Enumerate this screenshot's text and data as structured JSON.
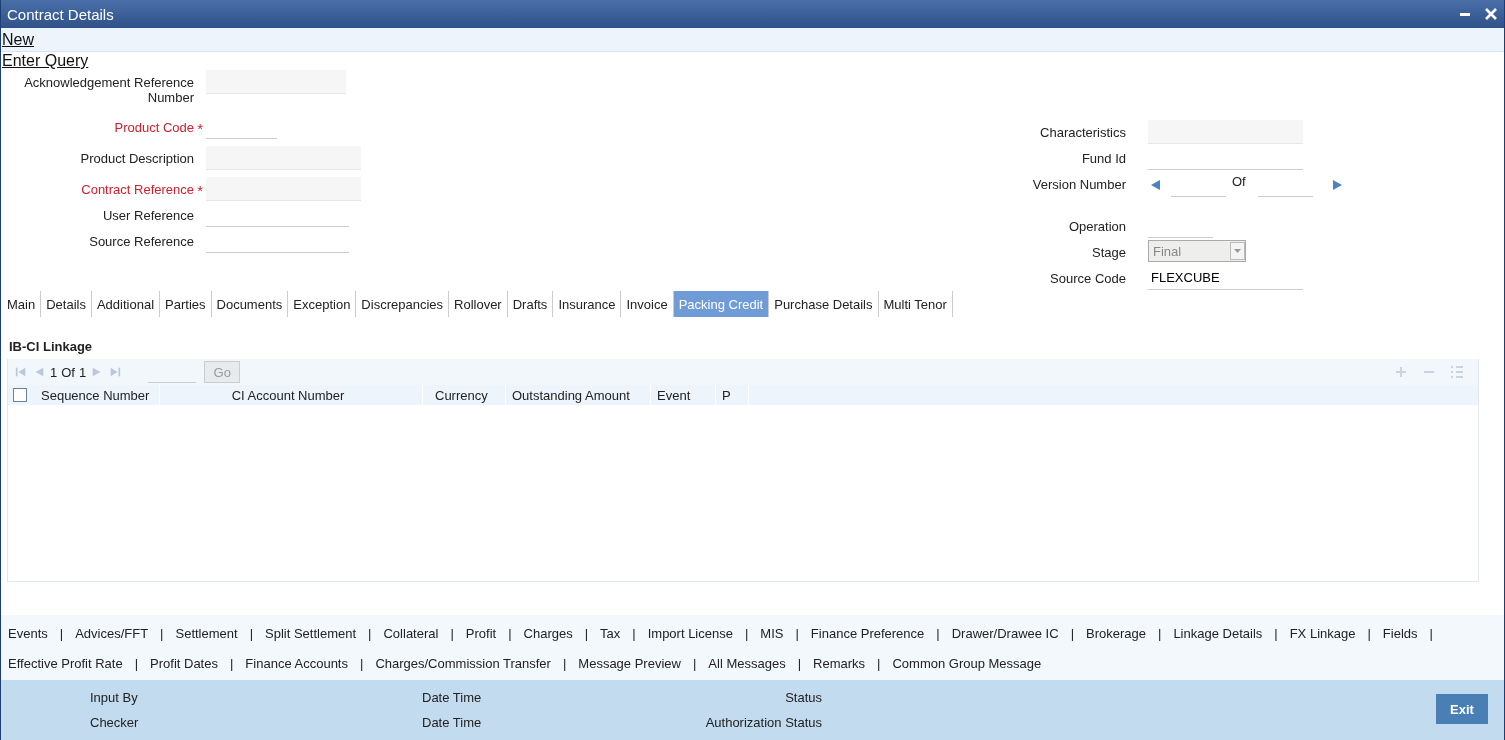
{
  "window": {
    "title": "Contract Details"
  },
  "actions": [
    {
      "label": "New"
    },
    {
      "label": "Enter Query"
    }
  ],
  "required_mark": "*",
  "left_fields": [
    {
      "label": "Acknowledgement Reference Number",
      "kind": "readonly",
      "required": false
    },
    {
      "label": "Product Code",
      "kind": "short",
      "required": true
    },
    {
      "label": "Product Description",
      "kind": "readonly",
      "required": false
    },
    {
      "label": "Contract Reference",
      "kind": "readonly",
      "required": true
    },
    {
      "label": "User Reference",
      "kind": "input",
      "required": false
    },
    {
      "label": "Source Reference",
      "kind": "input",
      "required": false
    }
  ],
  "right_fields": [
    {
      "label": "Characteristics",
      "kind": "readonly",
      "required": false
    },
    {
      "label": "Fund Id",
      "kind": "input",
      "required": false
    },
    {
      "label": "Version Number",
      "kind": "version",
      "of_label": "Of",
      "required": false
    },
    {
      "label": "Operation",
      "kind": "short",
      "required": false
    },
    {
      "label": "Stage",
      "kind": "select",
      "value": "Final",
      "disabled": true,
      "required": false
    },
    {
      "label": "Source Code",
      "kind": "input",
      "value": "FLEXCUBE",
      "required": false
    }
  ],
  "tabs": [
    {
      "label": "Main",
      "selected": false
    },
    {
      "label": "Details",
      "selected": false
    },
    {
      "label": "Additional",
      "selected": false
    },
    {
      "label": "Parties",
      "selected": false
    },
    {
      "label": "Documents",
      "selected": false
    },
    {
      "label": "Exception",
      "selected": false
    },
    {
      "label": "Discrepancies",
      "selected": false
    },
    {
      "label": "Rollover",
      "selected": false
    },
    {
      "label": "Drafts",
      "selected": false
    },
    {
      "label": "Insurance",
      "selected": false
    },
    {
      "label": "Invoice",
      "selected": false
    },
    {
      "label": "Packing Credit",
      "selected": true
    },
    {
      "label": "Purchase Details",
      "selected": false
    },
    {
      "label": "Multi Tenor",
      "selected": false
    }
  ],
  "section": {
    "title": "IB-CI Linkage"
  },
  "grid": {
    "page": "1",
    "of_label": "Of",
    "total": "1",
    "go_button": {
      "label": "Go",
      "disabled": true
    },
    "select_all": {
      "checked": false
    },
    "columns": [
      "Sequence Number",
      "CI Account Number",
      "Currency",
      "Outstanding Amount",
      "Event",
      "P"
    ]
  },
  "separator": "|",
  "link_rows": [
    {
      "trailing_separator": true,
      "links": [
        "Events",
        "Advices/FFT",
        "Settlement",
        "Split Settlement",
        "Collateral",
        "Profit",
        "Charges",
        "Tax",
        "Import License",
        "MIS",
        "Finance Preference",
        "Drawer/Drawee IC",
        "Brokerage",
        "Linkage Details",
        "FX Linkage",
        "Fields"
      ]
    },
    {
      "trailing_separator": false,
      "links": [
        "Effective Profit Rate",
        "Profit Dates",
        "Finance Accounts",
        "Charges/Commission Transfer",
        "Message Preview",
        "All Messages",
        "Remarks",
        "Common Group Message"
      ]
    }
  ],
  "audit": [
    [
      "Input By",
      "Date Time",
      "Status"
    ],
    [
      "Checker",
      "Date Time",
      "Authorization Status"
    ]
  ],
  "exit_button": {
    "label": "Exit"
  }
}
